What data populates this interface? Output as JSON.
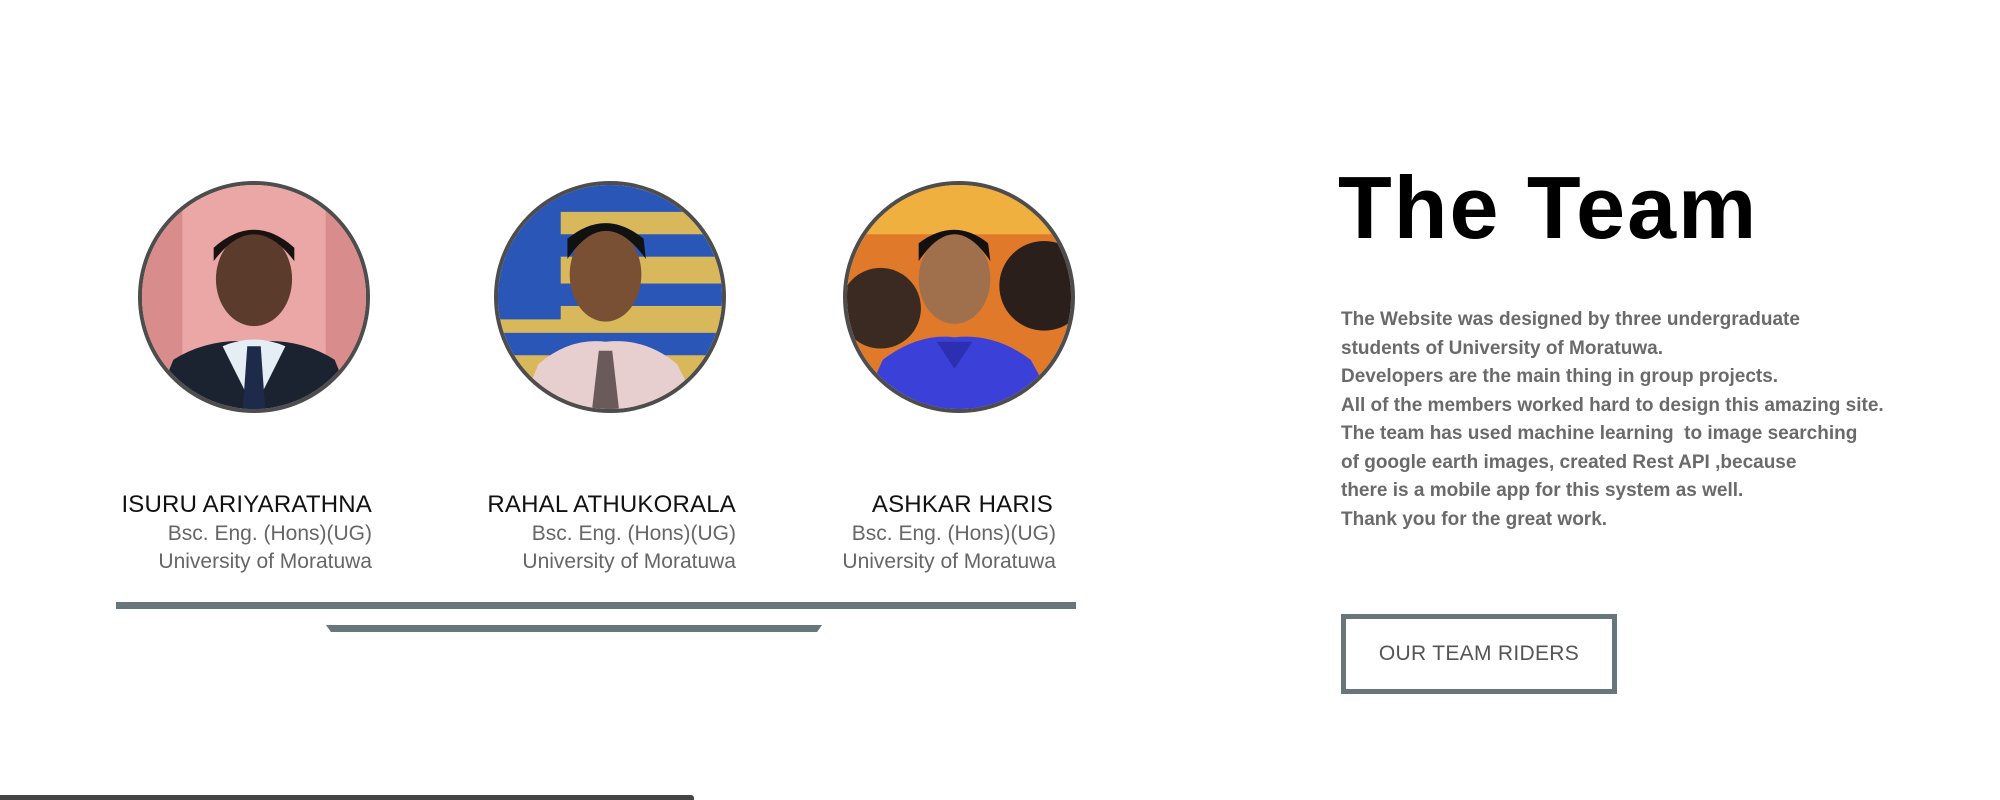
{
  "members": [
    {
      "name": "ISURU ARIYARATHNA",
      "degree": "Bsc. Eng. (Hons)(UG)",
      "university": "University of Moratuwa"
    },
    {
      "name": "RAHAL ATHUKORALA",
      "degree": "Bsc. Eng. (Hons)(UG)",
      "university": "University of Moratuwa"
    },
    {
      "name": "ASHKAR HARIS",
      "degree": "Bsc. Eng. (Hons)(UG)",
      "university": "University of Moratuwa"
    }
  ],
  "team": {
    "title": "The Team",
    "description_lines": [
      "The Website was designed by three undergraduate",
      "students of University of Moratuwa.",
      "Developers are the main thing in group projects.",
      "All of the members worked hard to design this amazing site.",
      "The team has used machine learning  to image searching",
      "of google earth images, created Rest API ,because",
      "there is a mobile app for this system as well.",
      "Thank you for the great work."
    ],
    "button_label": "OUR TEAM RIDERS"
  },
  "colors": {
    "accent": "#67767a",
    "avatar_border": "#4d4d4d",
    "text_muted": "#6a6a6a"
  }
}
